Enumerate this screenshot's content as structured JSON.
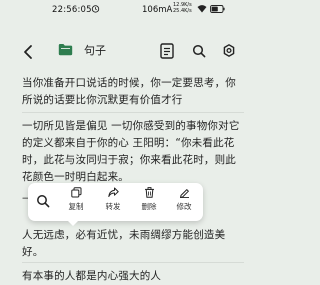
{
  "status_bar": {
    "time": "22:56:05",
    "network_speed": "106mA",
    "speed_line1": "12.9K/s",
    "speed_line2": "25.4K/s",
    "battery_level": 60
  },
  "toolbar": {
    "title": "句子",
    "icons": [
      "back-arrow-icon",
      "folder-icon",
      "notes-icon",
      "search-icon",
      "settings-icon"
    ]
  },
  "content": {
    "para1_line1": "当你准备开口说话的时候，你一定要思考，你",
    "para1_line2": "所说的话要比你沉默更有价值才行",
    "para2_line1": "一切所见皆是偏见 一切你感受到的事物你对它",
    "para2_line2": "的定义都来自于你的心 王阳明：“你未看此花",
    "para2_line3": "时，此花与汝同归于寂；你来看此花时，则此",
    "para2_line4": "花颜色一时明白起来。",
    "para2_partial": "—",
    "para3_line1": "人无远虑，必有近忧，未雨绸缪方能创造美",
    "para3_line2": "好。",
    "para4_line1": "有本事的人都是内心强大的人"
  },
  "popup": {
    "copy_label": "复制",
    "forward_label": "转发",
    "delete_label": "删除",
    "edit_label": "修改"
  },
  "colors": {
    "background": "#e9eee9",
    "folder_green": "#2e7d4f",
    "popup_bg": "#ffffff"
  }
}
